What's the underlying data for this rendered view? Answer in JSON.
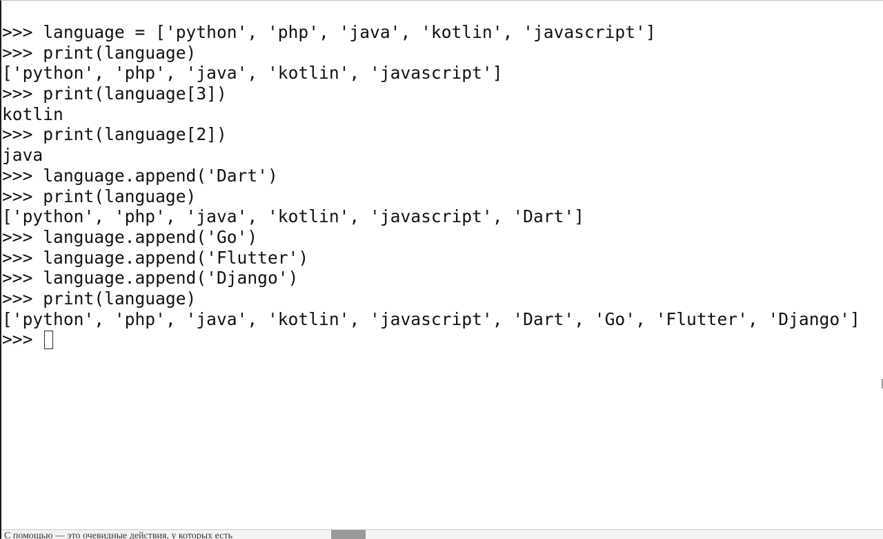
{
  "terminal": {
    "lines": [
      ">>> language = ['python', 'php', 'java', 'kotlin', 'javascript']",
      ">>> print(language)",
      "['python', 'php', 'java', 'kotlin', 'javascript']",
      ">>> print(language[3])",
      "kotlin",
      ">>> print(language[2])",
      "java",
      ">>> language.append('Dart')",
      ">>> print(language)",
      "['python', 'php', 'java', 'kotlin', 'javascript', 'Dart']",
      ">>> language.append('Go')",
      ">>> language.append('Flutter')",
      ">>> language.append('Django')",
      ">>> print(language)",
      "['python', 'php', 'java', 'kotlin', 'javascript', 'Dart', 'Go', 'Flutter', 'Django']"
    ],
    "prompt": ">>> "
  },
  "background_caption": "С помощью — это очевидные действия, у которых есть",
  "colors": {
    "text": "#111111",
    "background": "#ffffff"
  }
}
